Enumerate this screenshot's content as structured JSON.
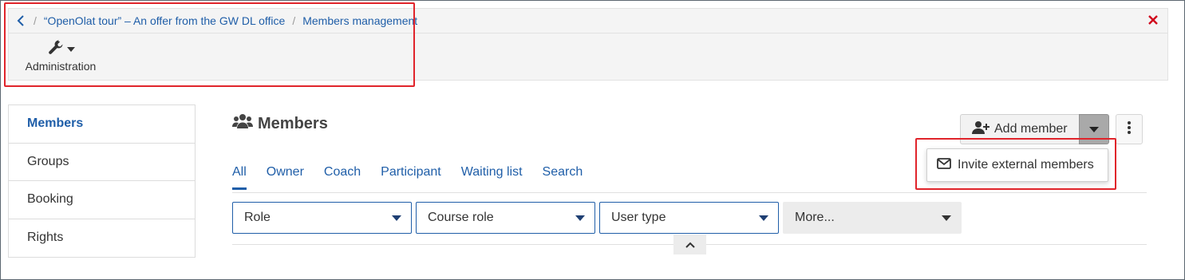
{
  "breadcrumb": {
    "items": [
      "“OpenOlat tour” – An offer from the GW DL office",
      "Members management"
    ],
    "separator": "/"
  },
  "toolbar": {
    "admin_label": "Administration"
  },
  "sidebar": {
    "items": [
      "Members",
      "Groups",
      "Booking",
      "Rights"
    ],
    "active": "Members"
  },
  "main": {
    "title": "Members",
    "add_member_label": "Add member",
    "dropdown_items": [
      "Invite external members"
    ],
    "tabs": [
      "All",
      "Owner",
      "Coach",
      "Participant",
      "Waiting list",
      "Search"
    ],
    "active_tab": "All",
    "filters": [
      "Role",
      "Course role",
      "User type",
      "More..."
    ]
  },
  "colors": {
    "link": "#1f5ea8",
    "highlight": "#e0242b",
    "close": "#d0021b"
  },
  "icons": [
    "chevron-left-icon",
    "close-icon",
    "wrench-icon",
    "users-icon",
    "user-plus-icon",
    "caret-down-icon",
    "kebab-icon",
    "envelope-icon",
    "chevron-up-icon"
  ]
}
